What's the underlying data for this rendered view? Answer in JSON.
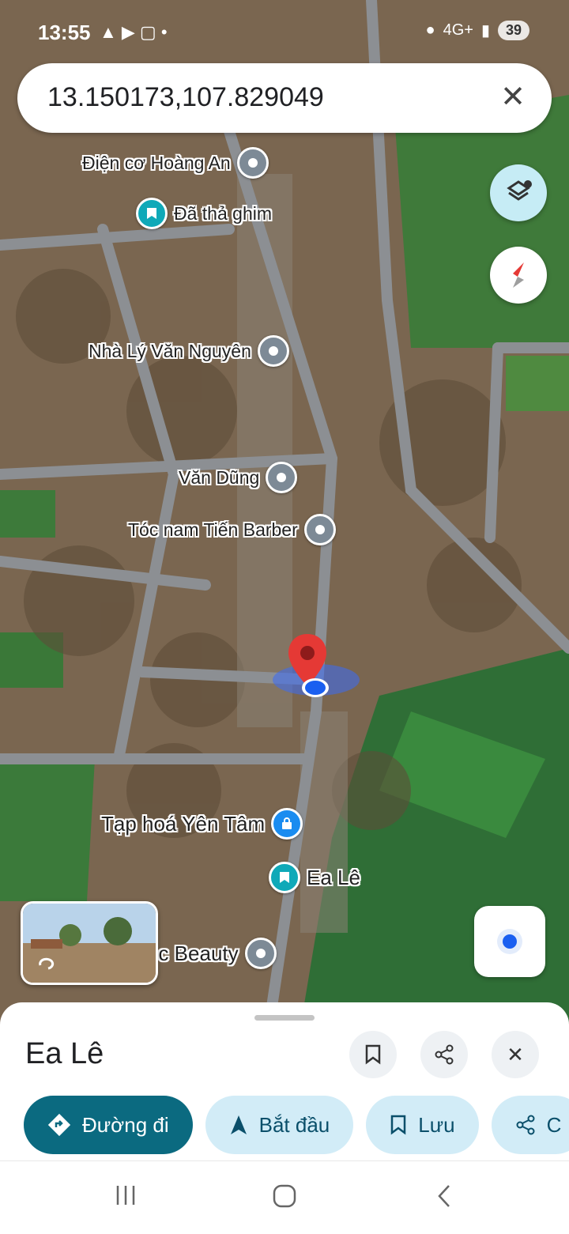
{
  "status_bar": {
    "time": "13:55",
    "left_icons": "▲ ▶ ▢ •",
    "network": "4G+",
    "battery": "39"
  },
  "search": {
    "query": "13.150173,107.829049"
  },
  "map": {
    "places": [
      {
        "name": "Điện cơ Hoàng An"
      },
      {
        "name": "Đã thả ghim"
      },
      {
        "name": "Nhà Lý Văn Nguyên"
      },
      {
        "name": "Văn Dũng"
      },
      {
        "name": "Tóc nam Tiến Barber"
      },
      {
        "name": "Tạp hoá Yên Tâm"
      },
      {
        "name": "Ea Lê"
      },
      {
        "name": "oc Beauty"
      }
    ]
  },
  "sheet": {
    "title": "Ea Lê",
    "chips": [
      {
        "label": "Đường đi"
      },
      {
        "label": "Bắt đầu"
      },
      {
        "label": "Lưu"
      },
      {
        "label": "C"
      }
    ]
  },
  "colors": {
    "primary": "#0b6a80",
    "chip_bg": "#d2ecf7",
    "pin_red": "#e53935"
  }
}
